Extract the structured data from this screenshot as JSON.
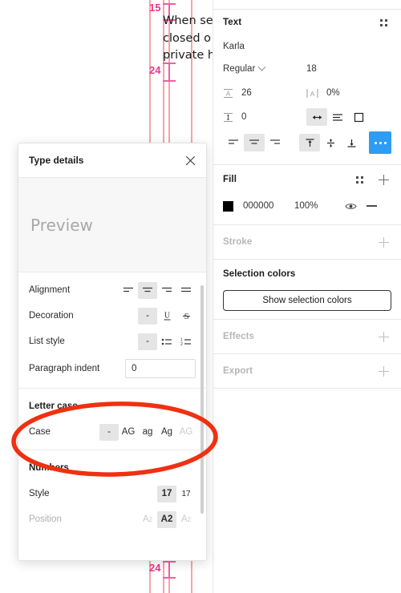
{
  "canvas": {
    "text_lines": [
      "When se",
      "closed o",
      "private h"
    ],
    "measurements": [
      {
        "label": "15"
      },
      {
        "label": "24"
      },
      {
        "label": "24"
      }
    ]
  },
  "right_panel": {
    "text": {
      "title": "Text",
      "grip_icon": "grip-dots-icon",
      "font_family": "Karla",
      "font_style": "Regular",
      "style_chevron_icon": "chevron-down-icon",
      "font_size": "18",
      "line_height_icon": "line-height-icon",
      "line_height": "26",
      "letter_spacing_icon": "letter-spacing-icon",
      "letter_spacing": "0%",
      "paragraph_spacing_icon": "paragraph-spacing-icon",
      "paragraph_spacing": "0",
      "resize_auto_width_icon": "auto-width-icon",
      "resize_auto_height_icon": "auto-height-icon",
      "resize_fixed_icon": "fixed-size-icon",
      "align_left_icon": "align-left-icon",
      "align_center_icon": "align-center-icon",
      "align_right_icon": "align-right-icon",
      "valign_top_icon": "align-top-icon",
      "valign_middle_icon": "align-middle-icon",
      "valign_bottom_icon": "align-bottom-icon",
      "more_icon": "more-options-icon"
    },
    "fill": {
      "title": "Fill",
      "grip_icon": "grip-dots-icon",
      "add_icon": "plus-icon",
      "color_hex": "000000",
      "color_value": "#000000",
      "opacity": "100%",
      "visibility_icon": "eye-icon",
      "remove_icon": "minus-icon"
    },
    "stroke": {
      "title": "Stroke",
      "add_icon": "plus-icon"
    },
    "selection_colors": {
      "title": "Selection colors",
      "button_label": "Show selection colors"
    },
    "effects": {
      "title": "Effects",
      "add_icon": "plus-icon"
    },
    "export": {
      "title": "Export",
      "add_icon": "plus-icon"
    }
  },
  "dialog": {
    "title": "Type details",
    "close_icon": "close-icon",
    "preview_placeholder": "Preview",
    "rows": {
      "alignment": {
        "label": "Alignment",
        "options": [
          "align-left-icon",
          "align-center-icon",
          "align-right-icon",
          "align-justify-icon"
        ],
        "selected_index": 1
      },
      "decoration": {
        "label": "Decoration",
        "options": [
          "-",
          "U",
          "S"
        ],
        "selected_index": 0
      },
      "list_style": {
        "label": "List style",
        "options": [
          "-",
          "bulleted-list-icon",
          "numbered-list-icon"
        ],
        "selected_index": 0
      },
      "paragraph_indent": {
        "label": "Paragraph indent",
        "value": "0"
      }
    },
    "letter_case": {
      "section_title": "Letter case",
      "label": "Case",
      "options": [
        "-",
        "AG",
        "ag",
        "Ag",
        "AG"
      ],
      "selected_index": 0,
      "disabled_index": 4
    },
    "numbers": {
      "section_title": "Numbers",
      "style": {
        "label": "Style",
        "options": [
          "17",
          "17"
        ],
        "selected_index": 0
      },
      "position": {
        "label": "Position",
        "options": [
          "A2",
          "A2",
          "A2"
        ],
        "selected_index": 1
      }
    }
  },
  "annotation": {
    "shape": "ellipse-highlight",
    "color": "#f03010",
    "targets": "Letter case / Case row"
  },
  "colors": {
    "accent_blue": "#2f9cf4",
    "annotation_red": "#f03010",
    "guide_pink": "#f3a6a6",
    "measure_pink": "#e8388a",
    "panel_border": "#e6e6e6"
  }
}
